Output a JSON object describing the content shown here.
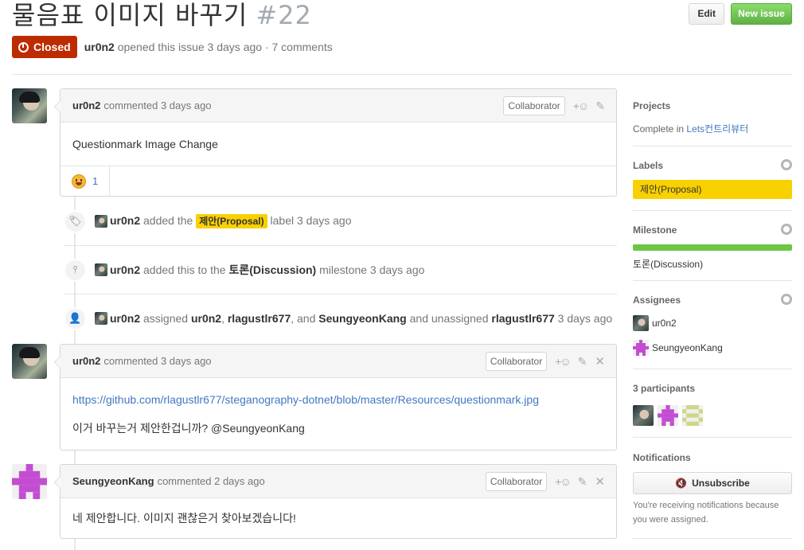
{
  "issue": {
    "title": "물음표 이미지 바꾸기",
    "number": "#22",
    "state": "Closed",
    "author": "ur0n2",
    "meta_suffix": "opened this issue 3 days ago · 7 comments"
  },
  "header": {
    "edit_label": "Edit",
    "new_issue_label": "New issue"
  },
  "comments": [
    {
      "author": "ur0n2",
      "action": "commented 3 days ago",
      "badge": "Collaborator",
      "body": "Questionmark Image Change",
      "reaction_count": "1"
    },
    {
      "author": "ur0n2",
      "action": "commented 3 days ago",
      "badge": "Collaborator",
      "link": "https://github.com/rlagustlr677/steganography-dotnet/blob/master/Resources/questionmark.jpg",
      "body": "이거 바꾸는거 제안한겁니까? @SeungyeonKang"
    },
    {
      "author": "SeungyeonKang",
      "action": "commented 2 days ago",
      "badge": "Collaborator",
      "body": "네 제안합니다. 이미지 괜찮은거 찾아보겠습니다!"
    }
  ],
  "events": {
    "label_event": {
      "actor": "ur0n2",
      "pre": "added the",
      "label": "제안(Proposal)",
      "post": "label 3 days ago"
    },
    "milestone_event": {
      "actor": "ur0n2",
      "pre": "added this to the",
      "milestone": "토론(Discussion)",
      "post": "milestone 3 days ago"
    },
    "assign_event": {
      "actor": "ur0n2",
      "pre": "assigned",
      "user1": "ur0n2",
      "sep1": ",",
      "user2": "rlagustlr677",
      "sep2": ", and",
      "user3": "SeungyeonKang",
      "mid": "and unassigned",
      "user4": "rlagustlr677",
      "post": "3 days ago"
    }
  },
  "sidebar": {
    "projects_heading": "Projects",
    "projects_prefix": "Complete in",
    "projects_link": "Lets컨트리뷰터",
    "labels_heading": "Labels",
    "label": "제안(Proposal)",
    "milestone_heading": "Milestone",
    "milestone_progress": 1.0,
    "milestone": "토론(Discussion)",
    "assignees_heading": "Assignees",
    "assignees": [
      "ur0n2",
      "SeungyeonKang"
    ],
    "participants_heading": "3 participants",
    "notifications_heading": "Notifications",
    "unsubscribe_label": "Unsubscribe",
    "notification_note": "You're receiving notifications because you were assigned."
  },
  "colors": {
    "closed": "#bd2c00",
    "label_proposal": "#f9d000",
    "new_issue": "#6cc644",
    "link": "#4078c0"
  }
}
